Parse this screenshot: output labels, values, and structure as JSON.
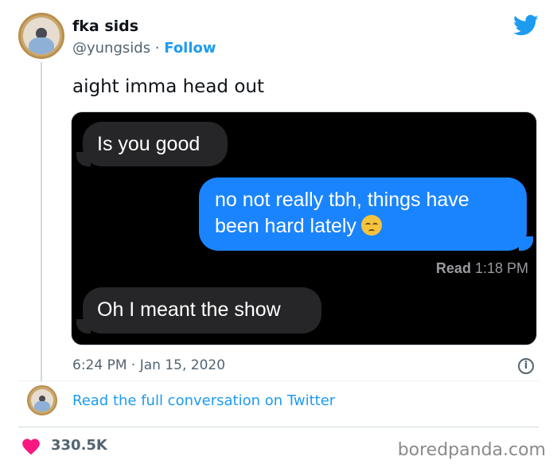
{
  "user": {
    "display_name": "fka sids",
    "handle": "@yungsids",
    "separator": " · ",
    "follow_label": "Follow"
  },
  "tweet": {
    "text": "aight imma head out",
    "timestamp": "6:24 PM · Jan 15, 2020"
  },
  "media": {
    "messages": [
      {
        "text": "Is you good",
        "side": "received"
      },
      {
        "text": "no not really tbh, things have been hard lately",
        "side": "sent",
        "emoji": "pensive-face"
      },
      {
        "text": "Oh I meant the show",
        "side": "received"
      }
    ],
    "read_label": "Read",
    "read_time": "1:18 PM"
  },
  "footer": {
    "read_full_label": "Read the full conversation on Twitter",
    "likes": "330.5K"
  },
  "watermark": "boredpanda.com",
  "colors": {
    "twitter_blue": "#1d9bf0",
    "imessage_blue": "#1a84fe",
    "imessage_gray": "#262628",
    "heart_red": "#f91880"
  }
}
